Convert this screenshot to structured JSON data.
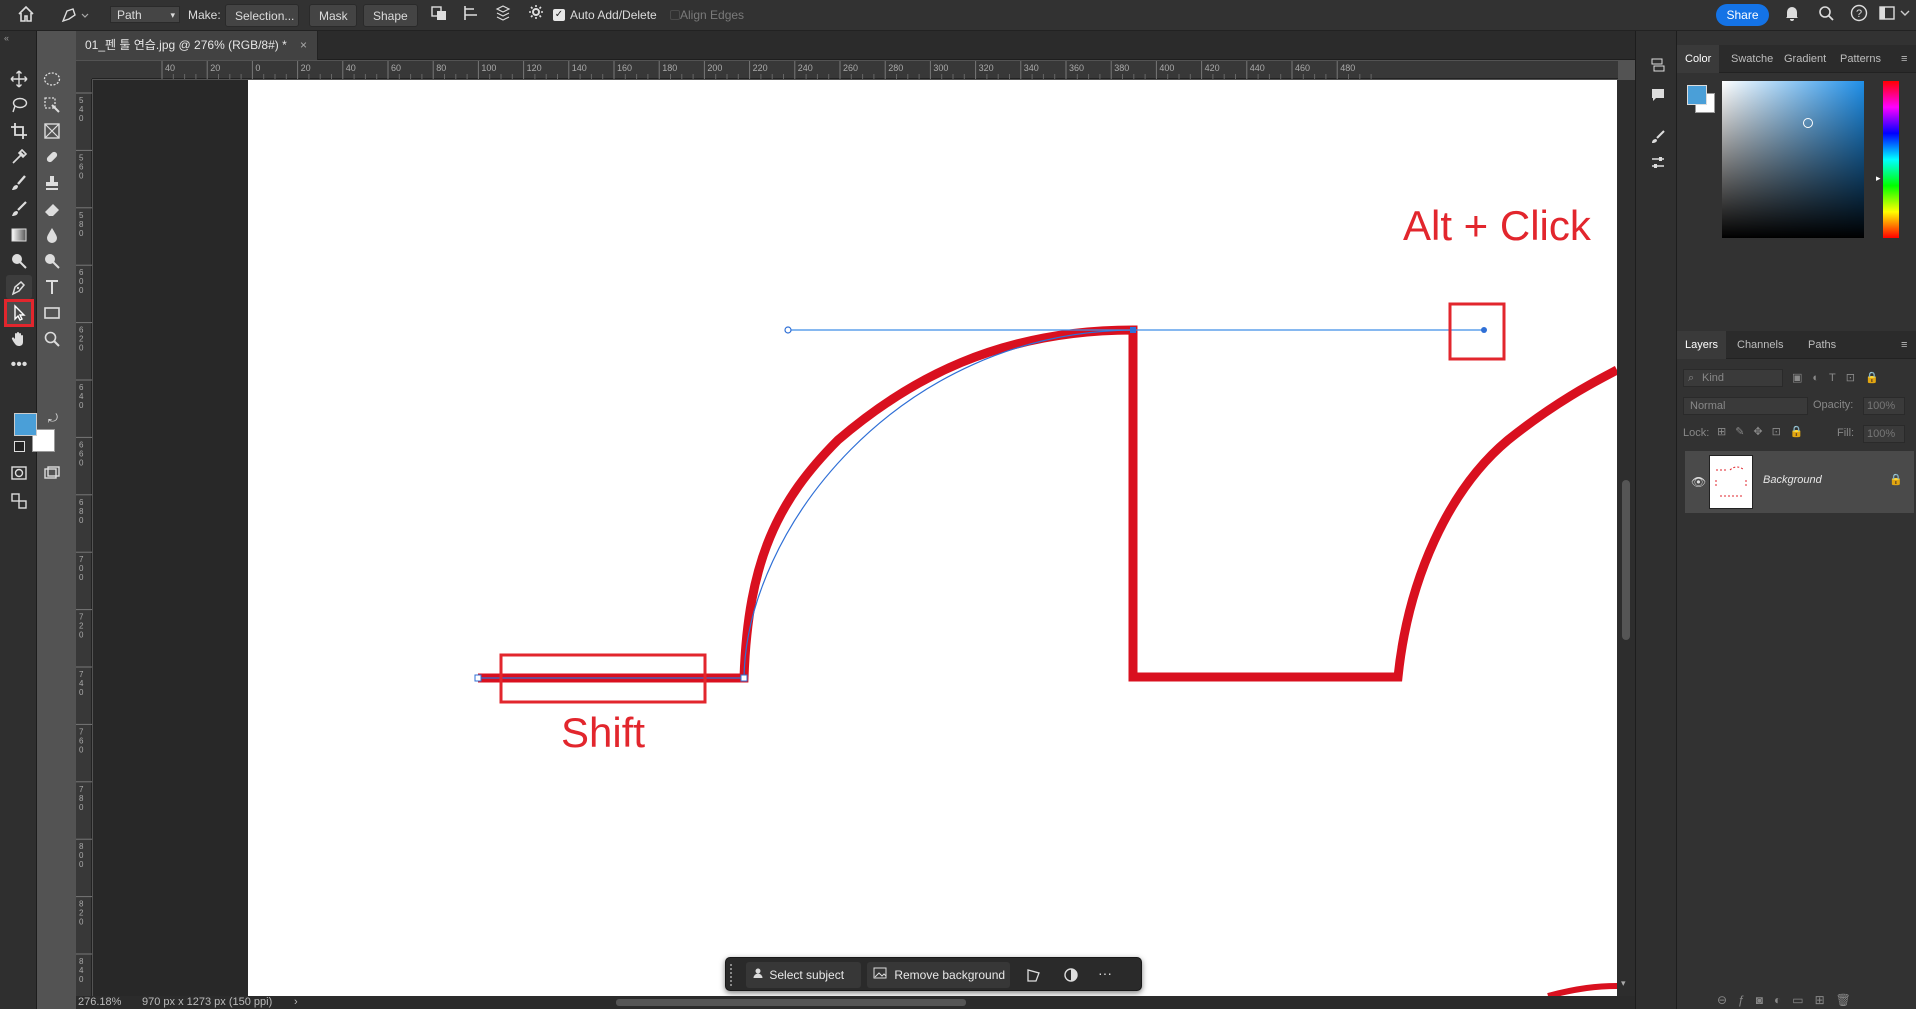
{
  "options_bar": {
    "path_mode": "Path",
    "make_label": "Make:",
    "selection_button": "Selection...",
    "mask_button": "Mask",
    "shape_button": "Shape",
    "auto_add_delete_label": "Auto Add/Delete",
    "auto_add_delete_checked": true,
    "align_edges_label": "Align Edges",
    "share_button": "Share"
  },
  "document": {
    "tab_title": "01_펜 툴 연습.jpg @ 276% (RGB/8#) *",
    "tab_close": "×",
    "zoom": "276.18%",
    "doc_info": "970 px x 1273 px (150 ppi)"
  },
  "rulers": {
    "horizontal": [
      "40",
      "20",
      "0",
      "20",
      "40",
      "60",
      "80",
      "100",
      "120",
      "140",
      "160",
      "180",
      "200",
      "220",
      "240",
      "260",
      "280",
      "300",
      "320",
      "340",
      "360",
      "380",
      "400",
      "420",
      "440",
      "460",
      "480"
    ],
    "vertical": [
      "540",
      "560",
      "580",
      "600",
      "620",
      "640",
      "660",
      "680",
      "700",
      "720",
      "740",
      "760",
      "780",
      "800",
      "820",
      "840"
    ]
  },
  "annotations": {
    "alt_click": "Alt + Click",
    "shift": "Shift",
    "color": "#e2262d"
  },
  "context_bar": {
    "select_subject": "Select subject",
    "remove_background": "Remove background",
    "more": "···"
  },
  "color_panel": {
    "tabs": [
      "Color",
      "Swatche",
      "Gradient",
      "Patterns"
    ],
    "foreground_color": "#4a9fd8",
    "background_color": "#ffffff"
  },
  "layers_panel": {
    "tabs": [
      "Layers",
      "Channels",
      "Paths"
    ],
    "kind_placeholder": "Kind",
    "blend_mode": "Normal",
    "opacity_label": "Opacity:",
    "opacity_value": "100%",
    "lock_label": "Lock:",
    "fill_label": "Fill:",
    "fill_value": "100%",
    "layers": [
      {
        "name": "Background",
        "visible": true,
        "locked": true
      }
    ]
  }
}
